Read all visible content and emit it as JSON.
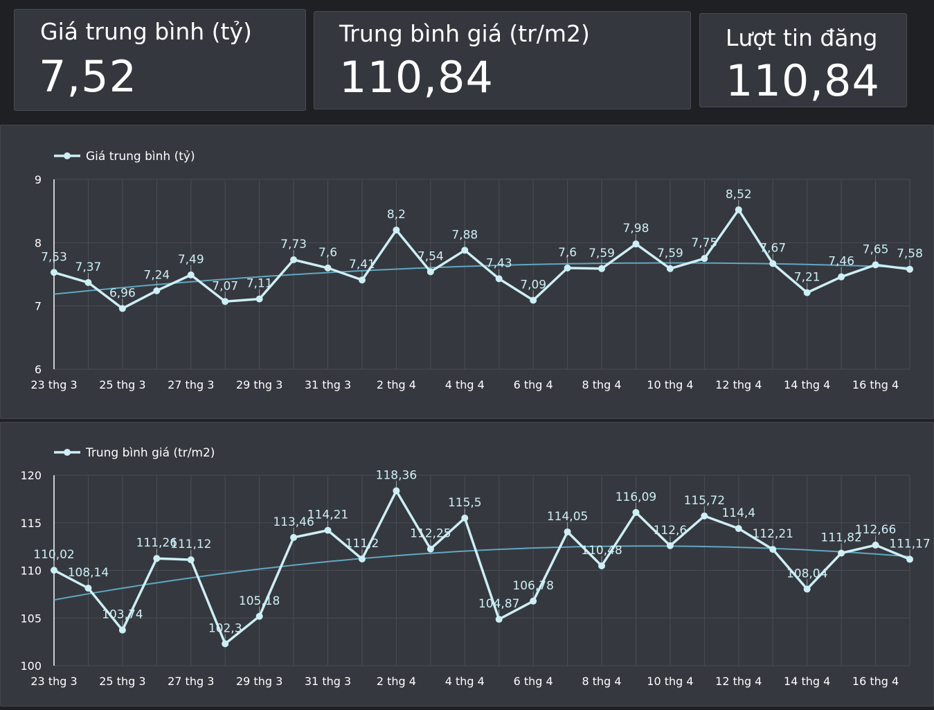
{
  "kpis": [
    {
      "title": "Giá trung bình (tỷ)",
      "value": "7,52"
    },
    {
      "title": "Trung bình giá (tr/m2)",
      "value": "110,84"
    },
    {
      "title": "Lượt tin đăng",
      "value": "110,84"
    }
  ],
  "colors": {
    "line": "#cdeff5",
    "trend": "#5fa8c4",
    "grid": "#4b4d55",
    "text": "#ffffff"
  },
  "chart_data": [
    {
      "type": "line",
      "legend": "Giá trung bình (tỷ)",
      "legend_position": "top-left",
      "grid": true,
      "trendline": true,
      "ylim": [
        6,
        9
      ],
      "yticks": [
        "6",
        "7",
        "8",
        "9"
      ],
      "xticks": [
        "23 thg 3",
        "25 thg 3",
        "27 thg 3",
        "29 thg 3",
        "31 thg 3",
        "2 thg 4",
        "4 thg 4",
        "6 thg 4",
        "8 thg 4",
        "10 thg 4",
        "12 thg 4",
        "14 thg 4",
        "16 thg 4"
      ],
      "values": [
        7.53,
        7.37,
        6.96,
        7.24,
        7.49,
        7.07,
        7.11,
        7.73,
        7.6,
        7.41,
        8.2,
        7.54,
        7.88,
        7.43,
        7.09,
        7.6,
        7.59,
        7.98,
        7.59,
        7.75,
        8.52,
        7.67,
        7.21,
        7.46,
        7.65,
        7.58
      ],
      "labels": [
        "7,53",
        "7,37",
        "6,96",
        "7,24",
        "7,49",
        "7,07",
        "7,11",
        "7,73",
        "7,6",
        "7,41",
        "8,2",
        "7,54",
        "7,88",
        "7,43",
        "7,09",
        "7,6",
        "7,59",
        "7,98",
        "7,59",
        "7,75",
        "8,52",
        "7,67",
        "7,21",
        "7,46",
        "7,65",
        "7,58"
      ]
    },
    {
      "type": "line",
      "legend": "Trung bình giá (tr/m2)",
      "legend_position": "top-left",
      "grid": true,
      "trendline": true,
      "ylim": [
        100,
        120
      ],
      "yticks": [
        "100",
        "105",
        "110",
        "115",
        "120"
      ],
      "xticks": [
        "23 thg 3",
        "25 thg 3",
        "27 thg 3",
        "29 thg 3",
        "31 thg 3",
        "2 thg 4",
        "4 thg 4",
        "6 thg 4",
        "8 thg 4",
        "10 thg 4",
        "12 thg 4",
        "14 thg 4",
        "16 thg 4"
      ],
      "values": [
        110.02,
        108.14,
        103.74,
        111.26,
        111.12,
        102.3,
        105.18,
        113.46,
        114.21,
        111.2,
        118.36,
        112.25,
        115.5,
        104.87,
        106.78,
        114.05,
        110.48,
        116.09,
        112.6,
        115.72,
        114.4,
        112.21,
        108.04,
        111.82,
        112.66,
        111.17
      ],
      "labels": [
        "110,02",
        "108,14",
        "103,74",
        "111,26",
        "111,12",
        "102,3",
        "105,18",
        "113,46",
        "114,21",
        "111,2",
        "118,36",
        "112,25",
        "115,5",
        "104,87",
        "106,78",
        "114,05",
        "110,48",
        "116,09",
        "112,6",
        "115,72",
        "114,4",
        "112,21",
        "108,04",
        "111,82",
        "112,66",
        "111,17"
      ]
    }
  ]
}
